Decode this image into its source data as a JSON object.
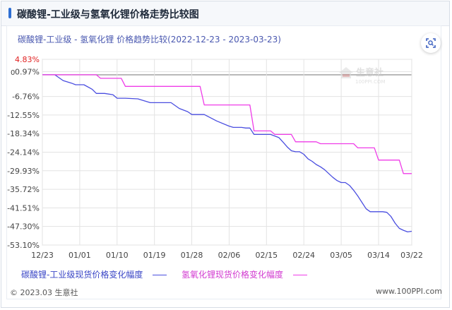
{
  "header": {
    "title": "碳酸锂-工业级与氢氧化锂价格走势比较图"
  },
  "subtitle": "碳酸锂-工业级 - 氢氧化锂 价格趋势比较(2022-12-23 - 2023-03-23)",
  "watermark": {
    "brand": "生意社",
    "url": "100PPI.COM"
  },
  "footer": {
    "left": "2023.03 生意社",
    "right": "www.100PPI.com"
  },
  "chart_data": {
    "type": "line",
    "ylim": [
      -53.1,
      4.83
    ],
    "grid": true,
    "y_ticks": [
      "4.83%",
      "0.97%",
      "-6.76%",
      "-12.55%",
      "-18.34%",
      "-24.14%",
      "-29.93%",
      "-35.72%",
      "-41.51%",
      "-47.30%",
      "-53.10%"
    ],
    "y_tick_values": [
      4.83,
      0.97,
      -6.76,
      -12.55,
      -18.34,
      -24.14,
      -29.93,
      -35.72,
      -41.51,
      -47.3,
      -53.1
    ],
    "zero_tick": "0",
    "x_ticks": [
      "12/23",
      "01/01",
      "01/10",
      "01/19",
      "01/28",
      "02/06",
      "02/15",
      "02/24",
      "03/05",
      "03/14",
      "03/22"
    ],
    "x_tick_days": [
      0,
      9,
      18,
      27,
      36,
      45,
      54,
      63,
      72,
      81,
      89
    ],
    "x_range_days": [
      0,
      89
    ],
    "colors": {
      "series1": "#4a4ee0",
      "series2": "#ef3ce8",
      "zero_line": "#9a9a9a",
      "grid": "#e3e3e3",
      "top_tick": "#e02020",
      "tick": "#444444"
    },
    "series": [
      {
        "name": "碳酸锂-工业级现货价格变化幅度",
        "days": [
          0,
          3,
          5,
          7,
          8,
          10,
          12,
          13,
          15,
          17,
          18,
          20,
          23,
          26,
          31,
          33,
          35,
          36,
          39,
          42,
          45,
          46,
          47,
          48,
          49,
          50,
          51,
          52,
          53,
          54,
          55,
          57,
          58,
          59,
          60,
          61,
          62,
          63,
          64,
          65,
          66,
          67,
          68,
          69,
          70,
          71,
          72,
          73,
          74,
          75,
          76,
          77,
          78,
          79,
          80,
          81,
          82,
          83,
          84,
          85,
          86,
          87,
          88,
          89
        ],
        "values": [
          0,
          0,
          -1.8,
          -2.6,
          -3.1,
          -3.1,
          -4.5,
          -5.8,
          -5.8,
          -6.2,
          -7.3,
          -7.3,
          -7.5,
          -8.7,
          -8.7,
          -10.5,
          -11.5,
          -12.4,
          -12.4,
          -14.4,
          -16.0,
          -16.4,
          -16.4,
          -16.4,
          -16.6,
          -16.6,
          -18.6,
          -18.6,
          -18.6,
          -18.6,
          -18.6,
          -19.6,
          -21.0,
          -22.5,
          -23.7,
          -24.0,
          -24.0,
          -24.8,
          -26.2,
          -27.0,
          -28.0,
          -28.7,
          -29.6,
          -30.8,
          -32.0,
          -33.0,
          -33.6,
          -33.6,
          -34.5,
          -36.0,
          -37.8,
          -39.8,
          -41.8,
          -42.7,
          -42.7,
          -42.7,
          -42.7,
          -42.9,
          -44.2,
          -46.3,
          -47.9,
          -48.5,
          -49.0,
          -48.8
        ]
      },
      {
        "name": "氢氧化锂现货价格变化幅度",
        "days": [
          0,
          13,
          14,
          19,
          20,
          38,
          39,
          50,
          51,
          55,
          56,
          60,
          61,
          66,
          67,
          75,
          76,
          80,
          81,
          85,
          86,
          87,
          88,
          89
        ],
        "values": [
          0,
          0,
          -1.1,
          -1.1,
          -3.6,
          -3.6,
          -9.4,
          -9.4,
          -17.5,
          -17.5,
          -18.6,
          -18.6,
          -20.9,
          -20.9,
          -21.5,
          -21.5,
          -22.8,
          -22.8,
          -26.6,
          -26.6,
          -26.6,
          -30.8,
          -30.8,
          -30.8
        ]
      }
    ]
  }
}
